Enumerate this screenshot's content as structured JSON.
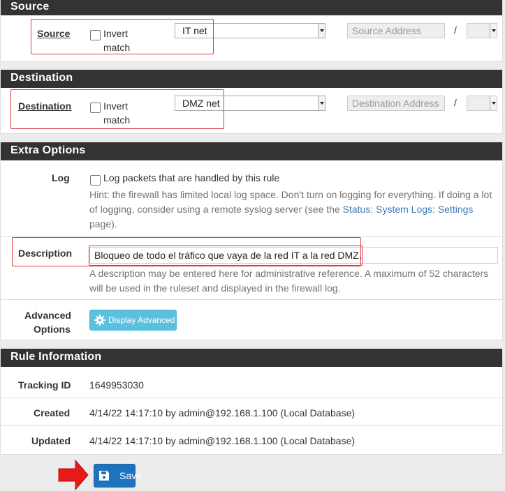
{
  "source": {
    "header": "Source",
    "label": "Source",
    "invert_line1": "Invert",
    "invert_line2": "match",
    "select_value": "IT net",
    "address_placeholder": "Source Address",
    "slash": "/"
  },
  "destination": {
    "header": "Destination",
    "label": "Destination",
    "invert_line1": "Invert",
    "invert_line2": "match",
    "select_value": "DMZ net",
    "address_placeholder": "Destination Address",
    "slash": "/"
  },
  "extra": {
    "header": "Extra Options",
    "log_label": "Log",
    "log_text": "Log packets that are handled by this rule",
    "log_hint_1": "Hint: the firewall has limited local log space. Don't turn on logging for everything. If doing a lot",
    "log_hint_2a": "of logging, consider using a remote syslog server (see the ",
    "log_hint_link": "Status: System Logs: Settings",
    "log_hint_3": "page).",
    "desc_label": "Description",
    "desc_value": "Bloqueo de todo el tráfico que vaya de la red IT a la red DMZ.",
    "desc_hint_1": "A description may be entered here for administrative reference. A maximum of 52 characters",
    "desc_hint_2": "will be used in the ruleset and displayed in the firewall log.",
    "adv_label_1": "Advanced",
    "adv_label_2": "Options",
    "adv_button": "Display Advanced"
  },
  "rule_info": {
    "header": "Rule Information",
    "tracking_label": "Tracking ID",
    "tracking_value": "1649953030",
    "created_label": "Created",
    "created_value": "4/14/22 14:17:10 by admin@192.168.1.100 (Local Database)",
    "updated_label": "Updated",
    "updated_value": "4/14/22 14:17:10 by admin@192.168.1.100 (Local Database)"
  },
  "save_button": "Save",
  "colors": {
    "highlight": "#e03a3a",
    "arrow": "#e8191b",
    "save": "#1e73be",
    "advanced": "#5bc0de",
    "link": "#3e7bb5"
  }
}
